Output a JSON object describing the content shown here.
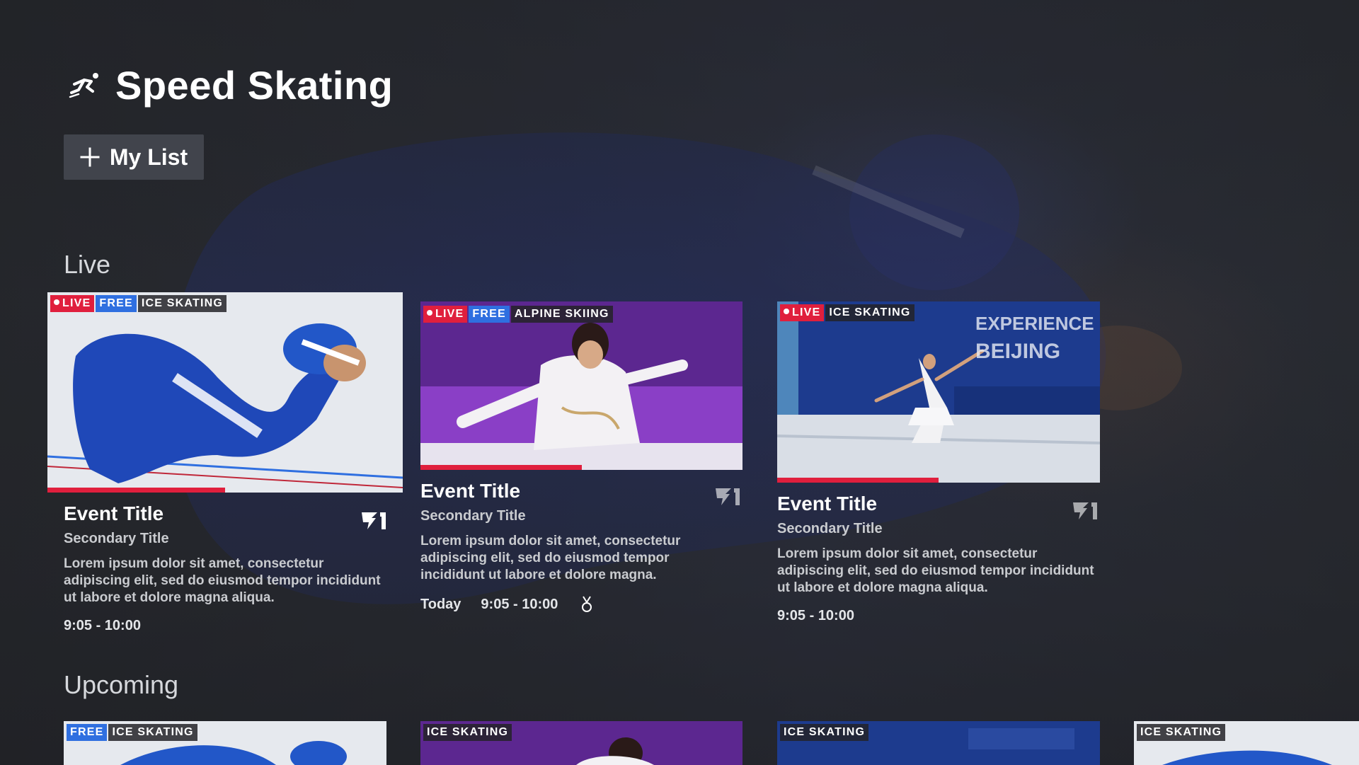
{
  "header": {
    "title": "Speed Skating",
    "icon": "speed-skater-icon"
  },
  "my_list": {
    "label": "My List",
    "icon": "plus-icon"
  },
  "sections": {
    "live_title": "Live",
    "upcoming_title": "Upcoming"
  },
  "live_cards": [
    {
      "badges": {
        "live": "LIVE",
        "free": "FREE",
        "sport": "ICE SKATING"
      },
      "title": "Event Title",
      "secondary": "Secondary Title",
      "desc_lines": [
        "Lorem ipsum dolor sit amet, consectetur",
        "adipiscing elit, sed do eiusmod tempor incididunt",
        "ut labore et dolore magna aliqua."
      ],
      "time": "9:05 - 10:00",
      "progress": 0.5
    },
    {
      "badges": {
        "live": "LIVE",
        "free": "FREE",
        "sport": "ALPINE SKIING"
      },
      "title": "Event Title",
      "secondary": "Secondary Title",
      "desc_lines": [
        "Lorem ipsum dolor sit amet, consectetur",
        "adipiscing elit, sed do eiusmod tempor",
        "incididunt ut labore et dolore magna."
      ],
      "day": "Today",
      "time": "9:05 - 10:00",
      "medal_icon": "medal-icon",
      "progress": 0.5
    },
    {
      "badges": {
        "live": "LIVE",
        "sport": "ICE SKATING"
      },
      "title": "Event Title",
      "secondary": "Secondary Title",
      "desc_lines": [
        "Lorem ipsum dolor sit amet, consectetur",
        "adipiscing elit, sed do eiusmod tempor incididunt",
        "ut labore et dolore magna aliqua."
      ],
      "time": "9:05 - 10:00",
      "progress": 0.5
    }
  ],
  "upcoming_cards": [
    {
      "badges": {
        "free": "FREE",
        "sport": "ICE SKATING"
      }
    },
    {
      "badges": {
        "sport": "ICE SKATING"
      }
    },
    {
      "badges": {
        "sport": "ICE SKATING"
      }
    },
    {
      "badges": {
        "sport": "ICE SKATING"
      }
    }
  ],
  "colors": {
    "live": "#e01f3d",
    "free": "#2f6fe0",
    "background": "#2a2c31"
  }
}
